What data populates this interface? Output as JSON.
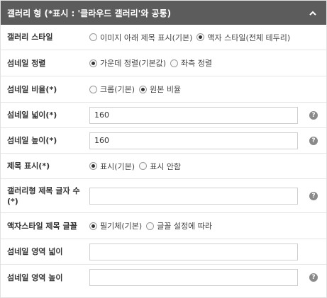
{
  "header": {
    "title": "갤러리 형 (*표시 : '클라우드 갤러리'와 공통)",
    "toggle_icon": "chevron-up-icon"
  },
  "rows": [
    {
      "label": "갤러리 스타일",
      "options": [
        "이미지 아래 제목 표시(기본)",
        "액자 스타일(전체 테두리)"
      ],
      "selected": 1
    },
    {
      "label": "섬네일 정렬",
      "options": [
        "가운데 정렬(기본값)",
        "좌측 정렬"
      ],
      "selected": 0
    },
    {
      "label": "섬네일 비율(*)",
      "options": [
        "크롭(기본)",
        "원본 비율"
      ],
      "selected": 1
    },
    {
      "label": "섬네일 넓이(*)",
      "value": "160"
    },
    {
      "label": "섬네일 높이(*)",
      "value": "160"
    },
    {
      "label": "제목 표시(*)",
      "options": [
        "표시(기본)",
        "표시 안함"
      ],
      "selected": 0
    },
    {
      "label": "갤러리형 제목 글자 수(*)",
      "value": ""
    },
    {
      "label": "액자스타일 제목 글꼴",
      "options": [
        "필기체(기본)",
        "글꼴 설정에 따라"
      ],
      "selected": 0
    },
    {
      "label": "섬네일 영역 넓이",
      "value": ""
    },
    {
      "label": "섬네일 영역 높이",
      "value": ""
    }
  ],
  "help_icon": "?"
}
